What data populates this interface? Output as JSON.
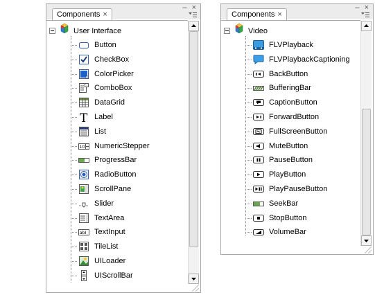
{
  "panels": [
    {
      "tab_label": "Components",
      "close_glyph": "×",
      "window_controls": "– ×",
      "root_label": "User Interface",
      "root_icon": "components-cube-icon",
      "items": [
        {
          "label": "Button",
          "icon": "button-icon"
        },
        {
          "label": "CheckBox",
          "icon": "checkbox-icon"
        },
        {
          "label": "ColorPicker",
          "icon": "colorpicker-icon"
        },
        {
          "label": "ComboBox",
          "icon": "combobox-icon"
        },
        {
          "label": "DataGrid",
          "icon": "datagrid-icon"
        },
        {
          "label": "Label",
          "icon": "label-icon"
        },
        {
          "label": "List",
          "icon": "list-icon"
        },
        {
          "label": "NumericStepper",
          "icon": "numericstepper-icon"
        },
        {
          "label": "ProgressBar",
          "icon": "progressbar-icon"
        },
        {
          "label": "RadioButton",
          "icon": "radiobutton-icon"
        },
        {
          "label": "ScrollPane",
          "icon": "scrollpane-icon"
        },
        {
          "label": "Slider",
          "icon": "slider-icon"
        },
        {
          "label": "TextArea",
          "icon": "textarea-icon"
        },
        {
          "label": "TextInput",
          "icon": "textinput-icon"
        },
        {
          "label": "TileList",
          "icon": "tilelist-icon"
        },
        {
          "label": "UILoader",
          "icon": "uiloader-icon"
        },
        {
          "label": "UIScrollBar",
          "icon": "uiscrollbar-icon"
        }
      ],
      "scroll_position": 0.0
    },
    {
      "tab_label": "Components",
      "close_glyph": "×",
      "window_controls": "– ×",
      "root_label": "Video",
      "root_icon": "components-cube-icon",
      "items": [
        {
          "label": "FLVPlayback",
          "icon": "flvplayback-icon"
        },
        {
          "label": "FLVPlaybackCaptioning",
          "icon": "captioning-icon"
        },
        {
          "label": "BackButton",
          "icon": "back-button-icon"
        },
        {
          "label": "BufferingBar",
          "icon": "bufferingbar-icon"
        },
        {
          "label": "CaptionButton",
          "icon": "caption-button-icon"
        },
        {
          "label": "ForwardButton",
          "icon": "forward-button-icon"
        },
        {
          "label": "FullScreenButton",
          "icon": "fullscreen-button-icon"
        },
        {
          "label": "MuteButton",
          "icon": "mute-button-icon"
        },
        {
          "label": "PauseButton",
          "icon": "pause-button-icon"
        },
        {
          "label": "PlayButton",
          "icon": "play-button-icon"
        },
        {
          "label": "PlayPauseButton",
          "icon": "playpause-button-icon"
        },
        {
          "label": "SeekBar",
          "icon": "seekbar-icon"
        },
        {
          "label": "StopButton",
          "icon": "stop-button-icon"
        },
        {
          "label": "VolumeBar",
          "icon": "volumebar-icon"
        }
      ],
      "scroll_position": 1.0
    }
  ]
}
